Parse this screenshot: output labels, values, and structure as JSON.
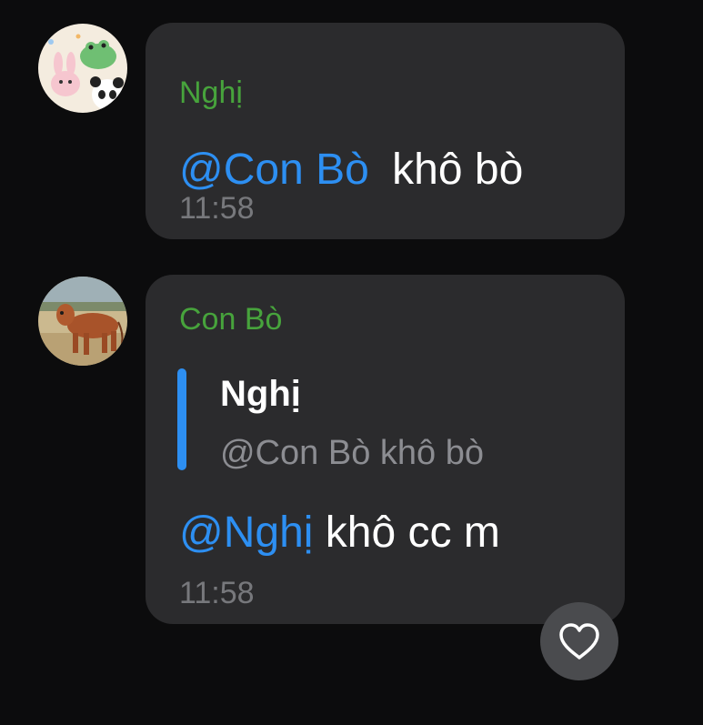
{
  "messages": [
    {
      "sender": "Nghị",
      "mention": "@Con Bò",
      "text": " khô bò",
      "time": "11:58"
    },
    {
      "sender": "Con Bò",
      "reply": {
        "sender": "Nghị",
        "text": "@Con Bò  khô bò"
      },
      "mention": "@Nghị",
      "text": " khô cc m",
      "time": "11:58"
    }
  ],
  "colors": {
    "background": "#0c0c0d",
    "bubble": "#2b2b2d",
    "sender_name": "#47a33c",
    "mention": "#2d8ff2",
    "message_text": "#ffffff",
    "timestamp": "#77787c",
    "quote_text": "#8c8d92"
  },
  "icons": {
    "reaction": "heart-icon"
  }
}
